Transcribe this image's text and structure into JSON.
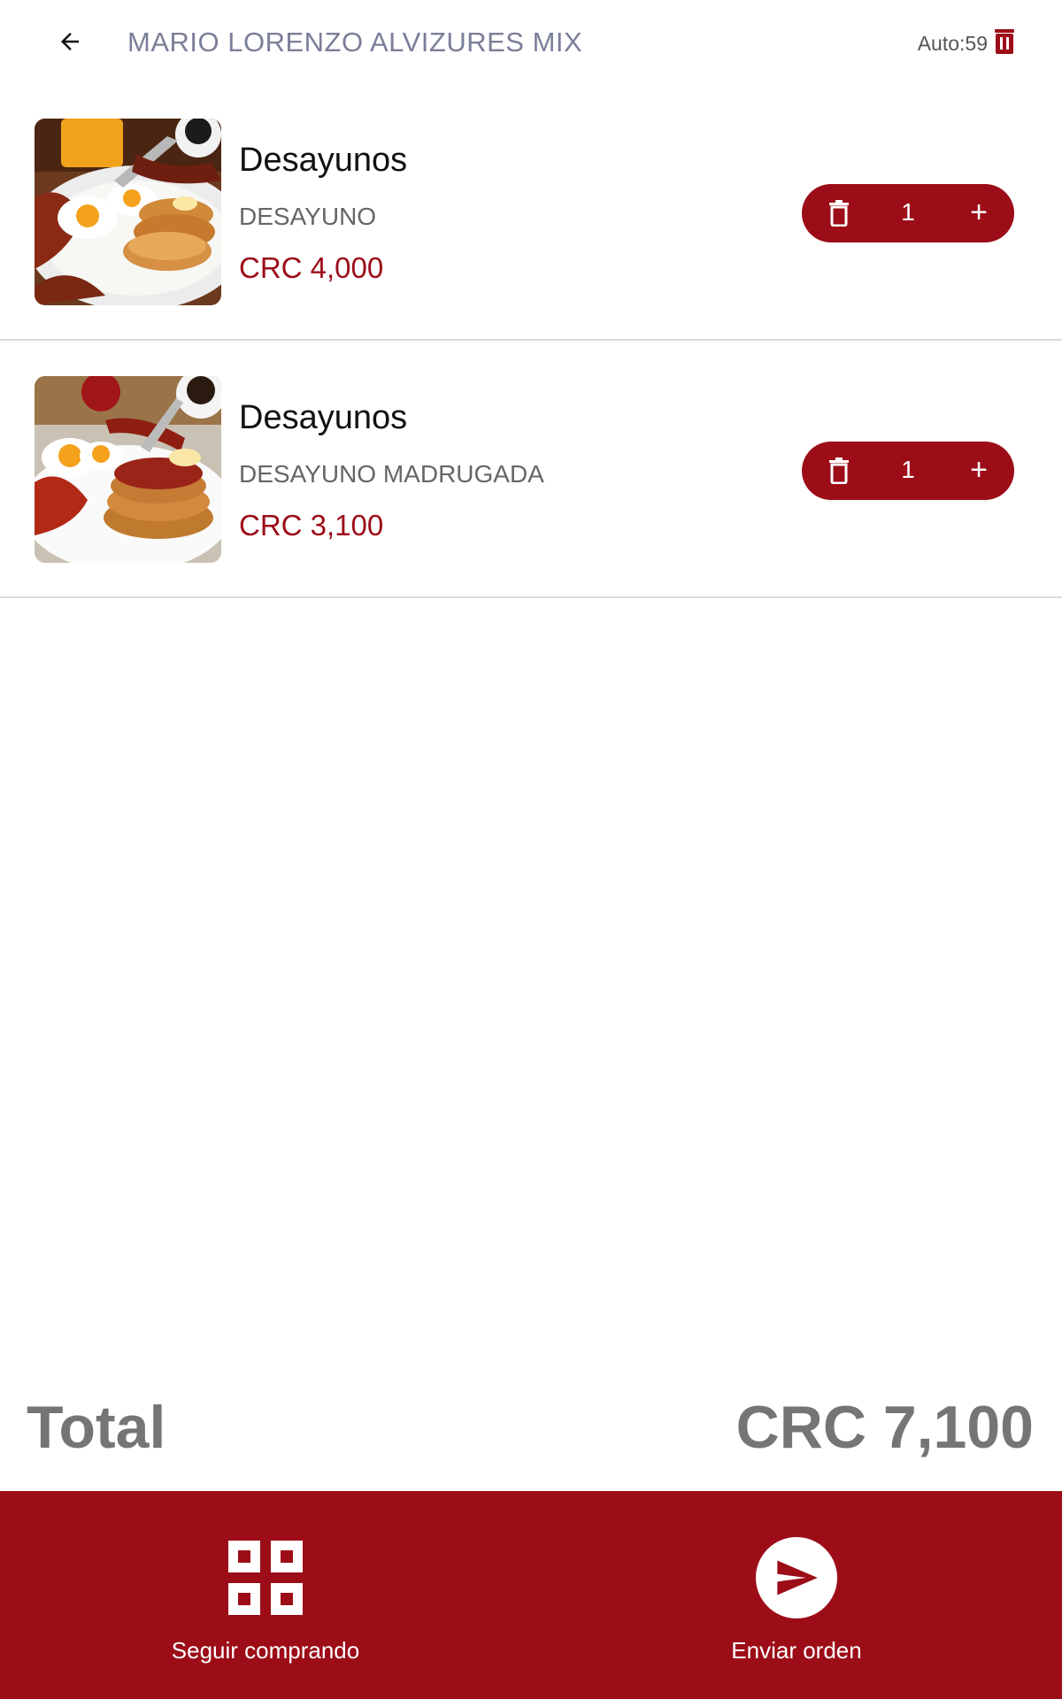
{
  "header": {
    "title": "MARIO LORENZO ALVIZURES MIX",
    "auto_label": "Auto:59"
  },
  "cart": {
    "items": [
      {
        "name": "Desayunos",
        "subtitle": "DESAYUNO",
        "price": "CRC 4,000",
        "quantity": "1",
        "add_symbol": "+"
      },
      {
        "name": "Desayunos",
        "subtitle": "DESAYUNO MADRUGADA",
        "price": "CRC 3,100",
        "quantity": "1",
        "add_symbol": "+"
      }
    ]
  },
  "total": {
    "label": "Total",
    "value": "CRC 7,100"
  },
  "bottom_bar": {
    "continue_label": "Seguir comprando",
    "send_label": "Enviar orden"
  },
  "colors": {
    "accent": "#9c0d18",
    "title": "#7a7e98",
    "total": "#757575"
  },
  "icons": [
    "back-arrow-icon",
    "trash-icon",
    "delete-icon",
    "plus-icon",
    "grid-icon",
    "send-icon"
  ]
}
